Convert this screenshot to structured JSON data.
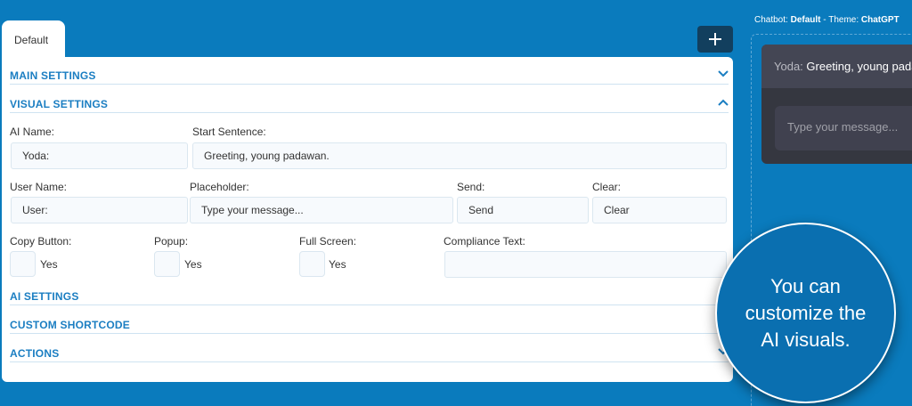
{
  "tab": {
    "label": "Default"
  },
  "add_button": {
    "icon": "plus-icon"
  },
  "sections": {
    "main": "MAIN SETTINGS",
    "visual": "VISUAL SETTINGS",
    "ai": "AI SETTINGS",
    "shortcode": "CUSTOM SHORTCODE",
    "actions": "ACTIONS"
  },
  "visual": {
    "ai_name_label": "AI Name:",
    "ai_name_value": "Yoda:",
    "start_sentence_label": "Start Sentence:",
    "start_sentence_value": "Greeting, young padawan.",
    "user_name_label": "User Name:",
    "user_name_value": "User:",
    "placeholder_label": "Placeholder:",
    "placeholder_value": "Type your message...",
    "send_label": "Send:",
    "send_value": "Send",
    "clear_label": "Clear:",
    "clear_value": "Clear",
    "copy_button_label": "Copy Button:",
    "popup_label": "Popup:",
    "full_screen_label": "Full Screen:",
    "compliance_label": "Compliance Text:",
    "compliance_value": "",
    "yes": "Yes"
  },
  "preview": {
    "caption_prefix": "Chatbot:",
    "chatbot_name": "Default",
    "caption_sep": " - Theme:",
    "theme_name": "ChatGPT",
    "ai_name": "Yoda:",
    "greeting": "Greeting, young padawan.",
    "input_placeholder": "Type your message..."
  },
  "callout": {
    "text": "You can customize the AI visuals."
  },
  "colors": {
    "background": "#0a7bbd",
    "section_title": "#1b7ec2",
    "add_button": "#123f5e",
    "chat_bg": "#353740",
    "chat_head": "#444654"
  }
}
